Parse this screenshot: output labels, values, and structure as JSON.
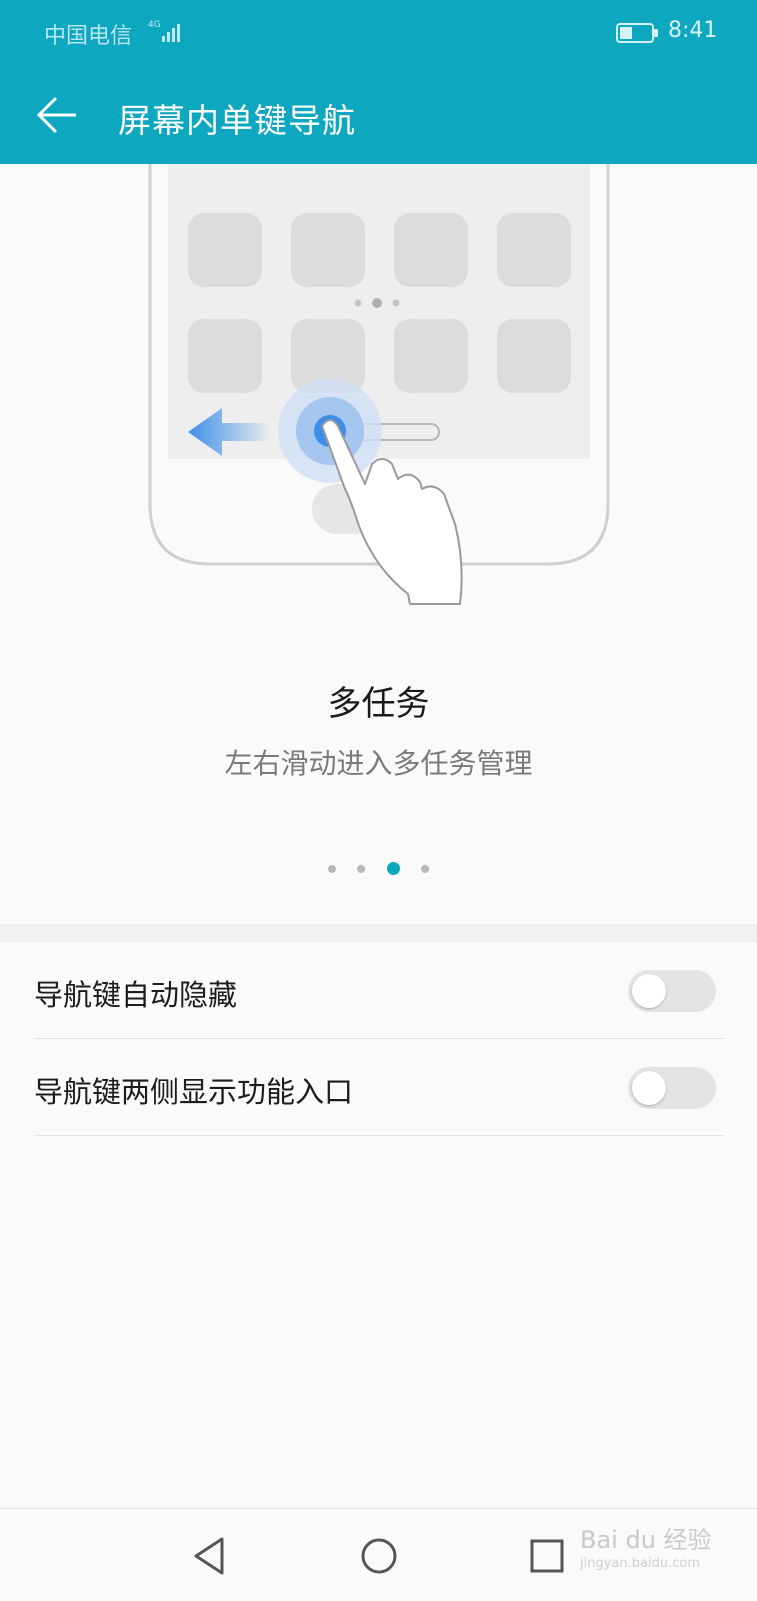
{
  "status_bar": {
    "carrier": "中国电信",
    "network_type": "4G",
    "time": "8:41",
    "icons": [
      "signal-icon",
      "battery-icon"
    ]
  },
  "app_bar": {
    "title": "屏幕内单键导航",
    "back_icon": "back-arrow-icon"
  },
  "tutorial": {
    "title": "多任务",
    "description": "左右滑动进入多任务管理",
    "pages": 4,
    "active_page": 3
  },
  "settings": [
    {
      "label": "导航键自动隐藏",
      "enabled": false
    },
    {
      "label": "导航键两侧显示功能入口",
      "enabled": false
    }
  ],
  "nav_bar": {
    "icons": [
      "back-triangle-icon",
      "home-circle-icon",
      "recents-square-icon"
    ]
  },
  "watermark": {
    "text": "Bai du 经验",
    "sub": "jingyan.baidu.com"
  },
  "colors": {
    "accent": "#0ea7c0",
    "toggle_off": "#e3e3e3"
  }
}
